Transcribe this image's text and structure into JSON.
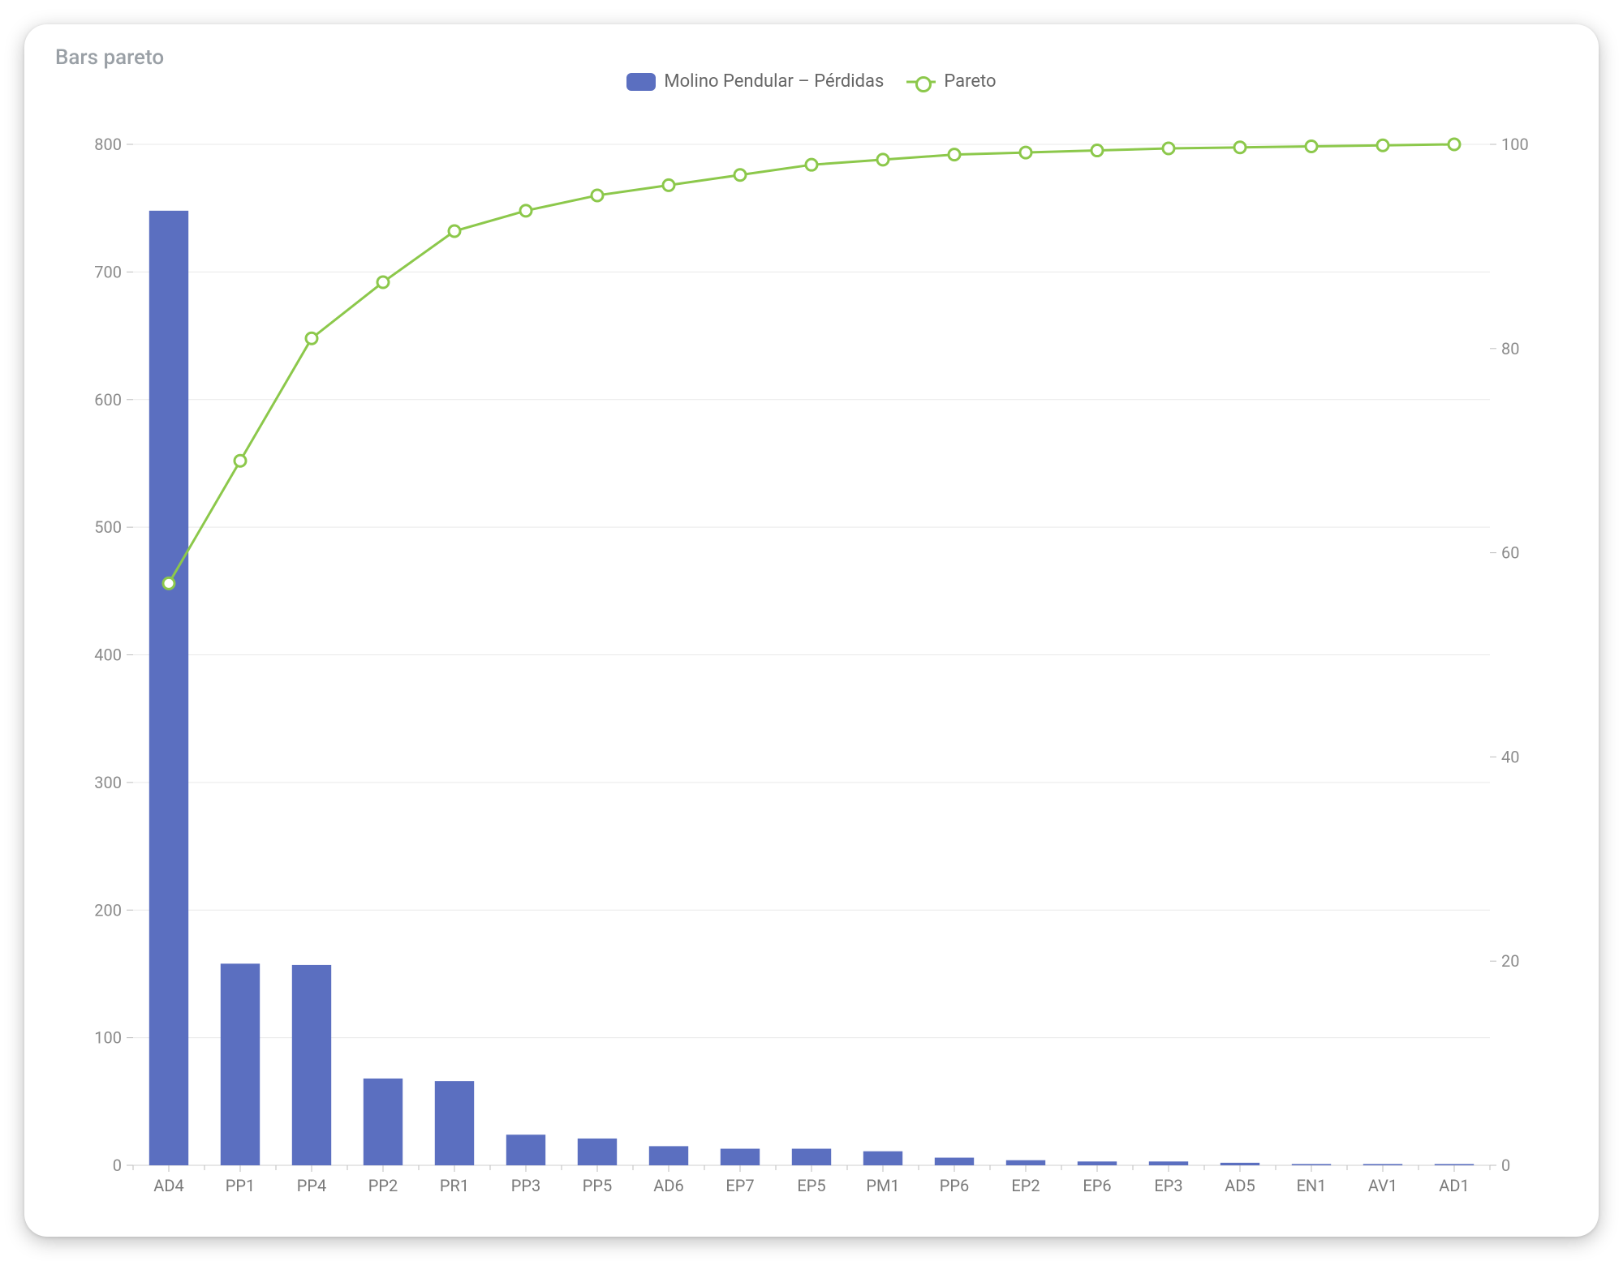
{
  "title": "Bars pareto",
  "legend": {
    "bar_label": "Molino Pendular – Pérdidas",
    "line_label": "Pareto"
  },
  "axes": {
    "y_left_ticks": [
      0,
      100,
      200,
      300,
      400,
      500,
      600,
      700,
      800
    ],
    "y_right_ticks": [
      0,
      20,
      40,
      60,
      80,
      100
    ],
    "y_left_max": 800,
    "y_right_min": 0,
    "y_right_max": 100
  },
  "chart_data": {
    "type": "bar",
    "title": "Bars pareto",
    "xlabel": "",
    "ylabel_left": "",
    "ylabel_right": "",
    "ylim_left": [
      0,
      800
    ],
    "ylim_right": [
      0,
      100
    ],
    "categories": [
      "AD4",
      "PP1",
      "PP4",
      "PP2",
      "PR1",
      "PP3",
      "PP5",
      "AD6",
      "EP7",
      "EP5",
      "PM1",
      "PP6",
      "EP2",
      "EP6",
      "EP3",
      "AD5",
      "EN1",
      "AV1",
      "AD1"
    ],
    "series": [
      {
        "name": "Molino Pendular – Pérdidas",
        "axis": "left",
        "type": "bar",
        "values": [
          748,
          158,
          157,
          68,
          66,
          24,
          21,
          15,
          13,
          13,
          11,
          6,
          4,
          3,
          3,
          2,
          1,
          1,
          1
        ]
      },
      {
        "name": "Pareto",
        "axis": "right",
        "type": "line",
        "values": [
          57,
          69,
          81,
          86.5,
          91.5,
          93.5,
          95,
          96,
          97,
          98,
          98.5,
          99,
          99.2,
          99.4,
          99.6,
          99.7,
          99.8,
          99.9,
          100
        ]
      }
    ]
  }
}
